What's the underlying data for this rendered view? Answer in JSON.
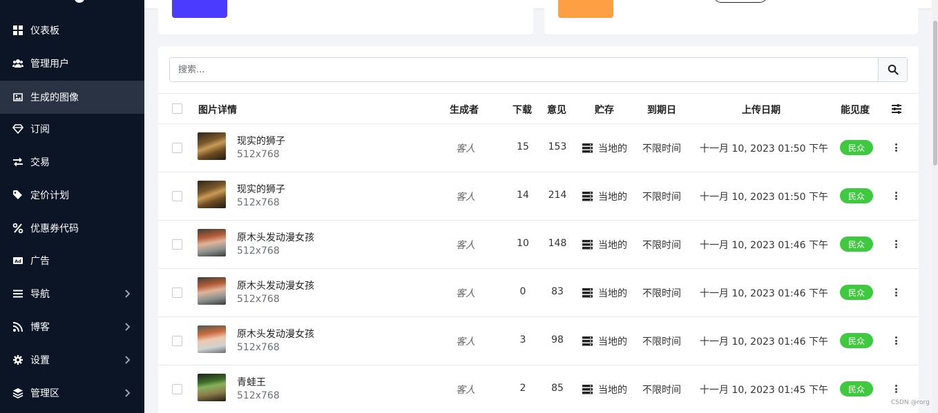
{
  "sidebar": {
    "items": [
      {
        "label": "仪表板",
        "icon": "dashboard-icon",
        "active": false,
        "chevron": false
      },
      {
        "label": "管理用户",
        "icon": "users-icon",
        "active": false,
        "chevron": false
      },
      {
        "label": "生成的图像",
        "icon": "images-icon",
        "active": true,
        "chevron": false
      },
      {
        "label": "订阅",
        "icon": "diamond-icon",
        "active": false,
        "chevron": false
      },
      {
        "label": "交易",
        "icon": "exchange-icon",
        "active": false,
        "chevron": false
      },
      {
        "label": "定价计划",
        "icon": "tags-icon",
        "active": false,
        "chevron": false
      },
      {
        "label": "优惠券代码",
        "icon": "percent-icon",
        "active": false,
        "chevron": false
      },
      {
        "label": "广告",
        "icon": "ad-icon",
        "active": false,
        "chevron": false
      },
      {
        "label": "导航",
        "icon": "bars-icon",
        "active": false,
        "chevron": true
      },
      {
        "label": "博客",
        "icon": "rss-icon",
        "active": false,
        "chevron": true
      },
      {
        "label": "设置",
        "icon": "gear-icon",
        "active": false,
        "chevron": true
      },
      {
        "label": "管理区",
        "icon": "layers-icon",
        "active": false,
        "chevron": true
      }
    ]
  },
  "search": {
    "placeholder": "搜索..."
  },
  "table": {
    "headers": {
      "details": "图片详情",
      "generator": "生成者",
      "downloads": "下载",
      "views": "意见",
      "storage": "贮存",
      "expiry": "到期日",
      "upload_date": "上传日期",
      "visibility": "能见度"
    },
    "rows": [
      {
        "title": "现实的狮子",
        "dims": "512x768",
        "generator": "客人",
        "downloads": "15",
        "views": "153",
        "storage": "当地的",
        "expiry": "不限时间",
        "upload_date": "十一月 10, 2023 01:50 下午",
        "visibility": "民众",
        "thumb": "lion"
      },
      {
        "title": "现实的狮子",
        "dims": "512x768",
        "generator": "客人",
        "downloads": "14",
        "views": "214",
        "storage": "当地的",
        "expiry": "不限时间",
        "upload_date": "十一月 10, 2023 01:50 下午",
        "visibility": "民众",
        "thumb": "lion"
      },
      {
        "title": "原木头发动漫女孩",
        "dims": "512x768",
        "generator": "客人",
        "downloads": "10",
        "views": "148",
        "storage": "当地的",
        "expiry": "不限时间",
        "upload_date": "十一月 10, 2023 01:46 下午",
        "visibility": "民众",
        "thumb": "girl"
      },
      {
        "title": "原木头发动漫女孩",
        "dims": "512x768",
        "generator": "客人",
        "downloads": "0",
        "views": "83",
        "storage": "当地的",
        "expiry": "不限时间",
        "upload_date": "十一月 10, 2023 01:46 下午",
        "visibility": "民众",
        "thumb": "girl"
      },
      {
        "title": "原木头发动漫女孩",
        "dims": "512x768",
        "generator": "客人",
        "downloads": "3",
        "views": "98",
        "storage": "当地的",
        "expiry": "不限时间",
        "upload_date": "十一月 10, 2023 01:46 下午",
        "visibility": "民众",
        "thumb": "girl2"
      },
      {
        "title": "青蛙王",
        "dims": "512x768",
        "generator": "客人",
        "downloads": "2",
        "views": "85",
        "storage": "当地的",
        "expiry": "不限时间",
        "upload_date": "十一月 10, 2023 01:45 下午",
        "visibility": "民众",
        "thumb": "frog"
      }
    ]
  },
  "watermark": "CSDN @rorg",
  "colors": {
    "sidebar_bg": "#0b1526",
    "active_bg": "#2a3343",
    "badge_green": "#3ec93e",
    "tile_blue": "#4b3bff",
    "tile_orange": "#ff9f43"
  }
}
